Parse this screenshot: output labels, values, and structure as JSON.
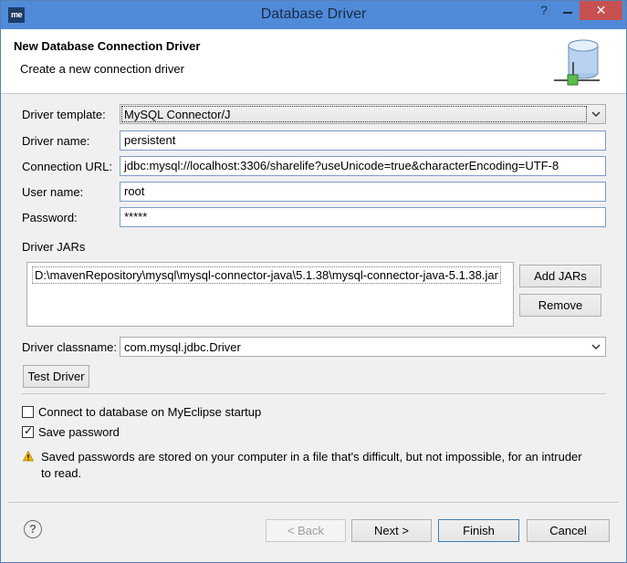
{
  "window": {
    "title": "Database Driver",
    "logo_text": "me",
    "help_glyph": "?",
    "minimize_glyph": "—",
    "close_glyph": "✕"
  },
  "banner": {
    "title": "New Database Connection Driver",
    "subtitle": "Create a new connection driver"
  },
  "form": {
    "driver_template_label": "Driver template:",
    "driver_template_value": "MySQL Connector/J",
    "driver_name_label": "Driver name:",
    "driver_name_value": "persistent",
    "connection_url_label": "Connection URL:",
    "connection_url_value": "jdbc:mysql://localhost:3306/sharelife?useUnicode=true&characterEncoding=UTF-8",
    "user_name_label": "User name:",
    "user_name_value": "root",
    "password_label": "Password:",
    "password_value": "*****"
  },
  "jars": {
    "section_label": "Driver JARs",
    "items": [
      "D:\\mavenRepository\\mysql\\mysql-connector-java\\5.1.38\\mysql-connector-java-5.1.38.jar"
    ],
    "add_label": "Add JARs",
    "remove_label": "Remove"
  },
  "classname": {
    "label": "Driver classname:",
    "value": "com.mysql.jdbc.Driver"
  },
  "test_driver_label": "Test Driver",
  "options": {
    "connect_on_startup_label": "Connect to database on MyEclipse startup",
    "connect_on_startup_checked": false,
    "save_password_label": "Save password",
    "save_password_checked": true
  },
  "warning": {
    "text": "Saved passwords are stored on your computer in a file that's difficult, but not impossible, for an intruder to read."
  },
  "footer": {
    "back_label": "< Back",
    "next_label": "Next >",
    "finish_label": "Finish",
    "cancel_label": "Cancel"
  },
  "colors": {
    "titlebar": "#4f8bd9",
    "close_button": "#c75050",
    "field_border": "#7a9ccb",
    "warning": "#f2b600"
  }
}
